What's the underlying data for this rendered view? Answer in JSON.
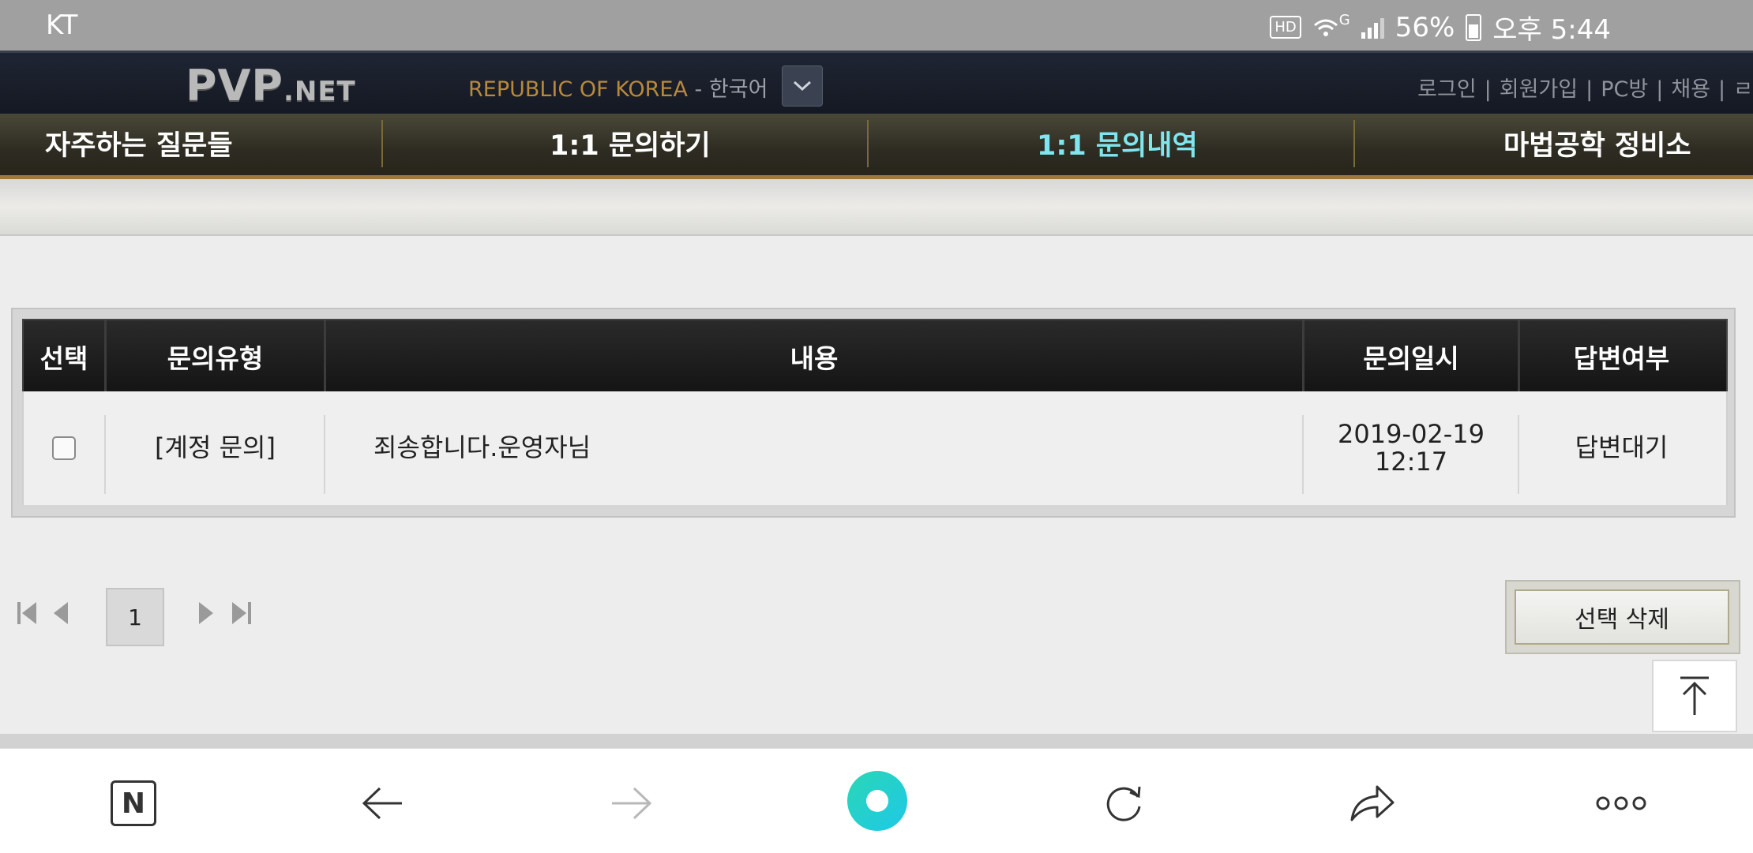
{
  "status_bar": {
    "carrier": "KT",
    "hd": "HD",
    "network": "G",
    "battery": "56%",
    "time": "오후 5:44"
  },
  "header": {
    "logo_main": "PVP",
    "logo_suffix": ".NET",
    "region": "REPUBLIC OF KOREA",
    "region_sep": " - ",
    "language": "한국어",
    "links": [
      "로그인",
      "회원가입",
      "PC방",
      "채용",
      "ㄹ"
    ]
  },
  "nav": {
    "items": [
      "자주하는 질문들",
      "1:1 문의하기",
      "1:1 문의내역",
      "마법공학 정비소"
    ],
    "active_index": 2
  },
  "table": {
    "headers": [
      "선택",
      "문의유형",
      "내용",
      "문의일시",
      "답변여부"
    ],
    "rows": [
      {
        "checked": false,
        "type": "[계정 문의]",
        "content": "죄송합니다.운영자님",
        "date": "2019-02-19",
        "time": "12:17",
        "status": "답변대기"
      }
    ]
  },
  "pagination": {
    "current_page": "1"
  },
  "actions": {
    "delete_selected": "선택 삭제"
  },
  "browser_bar": {
    "icons": [
      "naver-n-icon",
      "back-arrow-icon",
      "forward-arrow-icon",
      "home-icon",
      "refresh-icon",
      "share-icon",
      "more-icon"
    ],
    "naver_label": "N",
    "more_label": "ooo"
  },
  "colors": {
    "nav_active": "#7fe6f0",
    "region_gold": "#b8893b",
    "home_gradient_start": "#2ad7b4",
    "home_gradient_end": "#1ec8e8"
  }
}
